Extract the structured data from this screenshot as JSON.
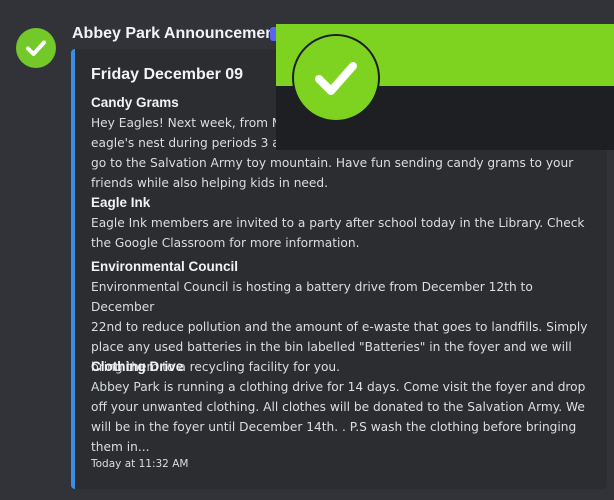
{
  "app": {
    "author_name": "Abbey Park Announcements",
    "colors": {
      "brand": "#74c92a",
      "accent_bar": "#3b8fe0",
      "background": "#313338",
      "embed": "#2b2d31"
    }
  },
  "message": {
    "avatar_icon": "checkmark-icon",
    "embed": {
      "title": "Friday December 09",
      "fields": [
        {
          "name": "Candy Grams",
          "value": "Hey Eagles! Next week, from Mo... eagle's nest during periods 3 an... go to the Salvation Army toy mountain. Have fun sending candy grams to your friends while also helping kids in need.",
          "lines": [
            "Hey Eagles! Next week, from Mo",
            "eagle's nest during periods 3 an",
            "go to the Salvation Army toy mountain. Have fun sending candy grams to your",
            "friends while also helping kids in need."
          ]
        },
        {
          "name": "Eagle Ink",
          "lines": [
            "Eagle Ink members are invited to a party after school today in the Library. Check",
            "the Google Classroom for more information."
          ]
        },
        {
          "name": "Environmental Council",
          "lines": [
            "Environmental Council is hosting a battery drive from December 12th to December",
            "22nd to reduce pollution and the amount of e-waste that goes to landfills. Simply",
            "place any used batteries in the bin labelled \"Batteries\" in the foyer and we will",
            "bring them to a recycling facility for you."
          ]
        },
        {
          "name": "Clothing Drive",
          "lines": [
            "Abbey Park is running a clothing drive for 14 days. Come visit the foyer and drop",
            "off your unwanted clothing. All clothes will be donated to the Salvation Army. We",
            "will be in the foyer until December 14th. . P.S wash the clothing before bringing",
            "them in..."
          ]
        }
      ],
      "footer": "Today at 11:32 AM"
    }
  },
  "overlay": {
    "icon": "checkmark-icon"
  }
}
